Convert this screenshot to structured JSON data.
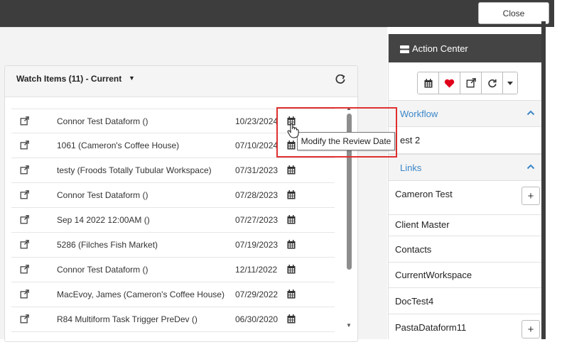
{
  "topbar": {
    "close_label": "Close"
  },
  "watch": {
    "title": "Watch Items (11) - Current",
    "items": [
      {
        "name": "Connor Test Dataform ()",
        "date": "10/23/2024"
      },
      {
        "name": "1061 (Cameron's Coffee House)",
        "date": "07/10/2024"
      },
      {
        "name": "testy (Froods Totally Tubular Workspace)",
        "date": "07/31/2023"
      },
      {
        "name": "Connor Test Dataform ()",
        "date": "07/28/2023"
      },
      {
        "name": "Sep 14 2022 12:00AM ()",
        "date": "07/27/2023"
      },
      {
        "name": "5286 (Filches Fish Market)",
        "date": "07/19/2023"
      },
      {
        "name": "Connor Test Dataform ()",
        "date": "12/11/2022"
      },
      {
        "name": "MacEvoy, James (Cameron's Coffee House)",
        "date": "07/29/2022"
      },
      {
        "name": "R84 Multiform Task Trigger PreDev ()",
        "date": "06/30/2020"
      }
    ]
  },
  "tooltip": {
    "text": "Modify the Review Date"
  },
  "action_center": {
    "title": "Action Center",
    "toolbar_icons": [
      "calendar-icon",
      "heart-icon",
      "external-link-icon",
      "refresh-icon",
      "caret-down-icon"
    ],
    "workflow": {
      "label": "Workflow",
      "item": "est 2"
    },
    "links": {
      "label": "Links",
      "items": [
        "Cameron Test",
        "Client Master",
        "Contacts",
        "CurrentWorkspace",
        "DocTest4",
        "PastaDataform11"
      ]
    }
  },
  "colors": {
    "accent": "#3a86c8",
    "highlight": "#e03030",
    "header_dark": "#444444"
  }
}
